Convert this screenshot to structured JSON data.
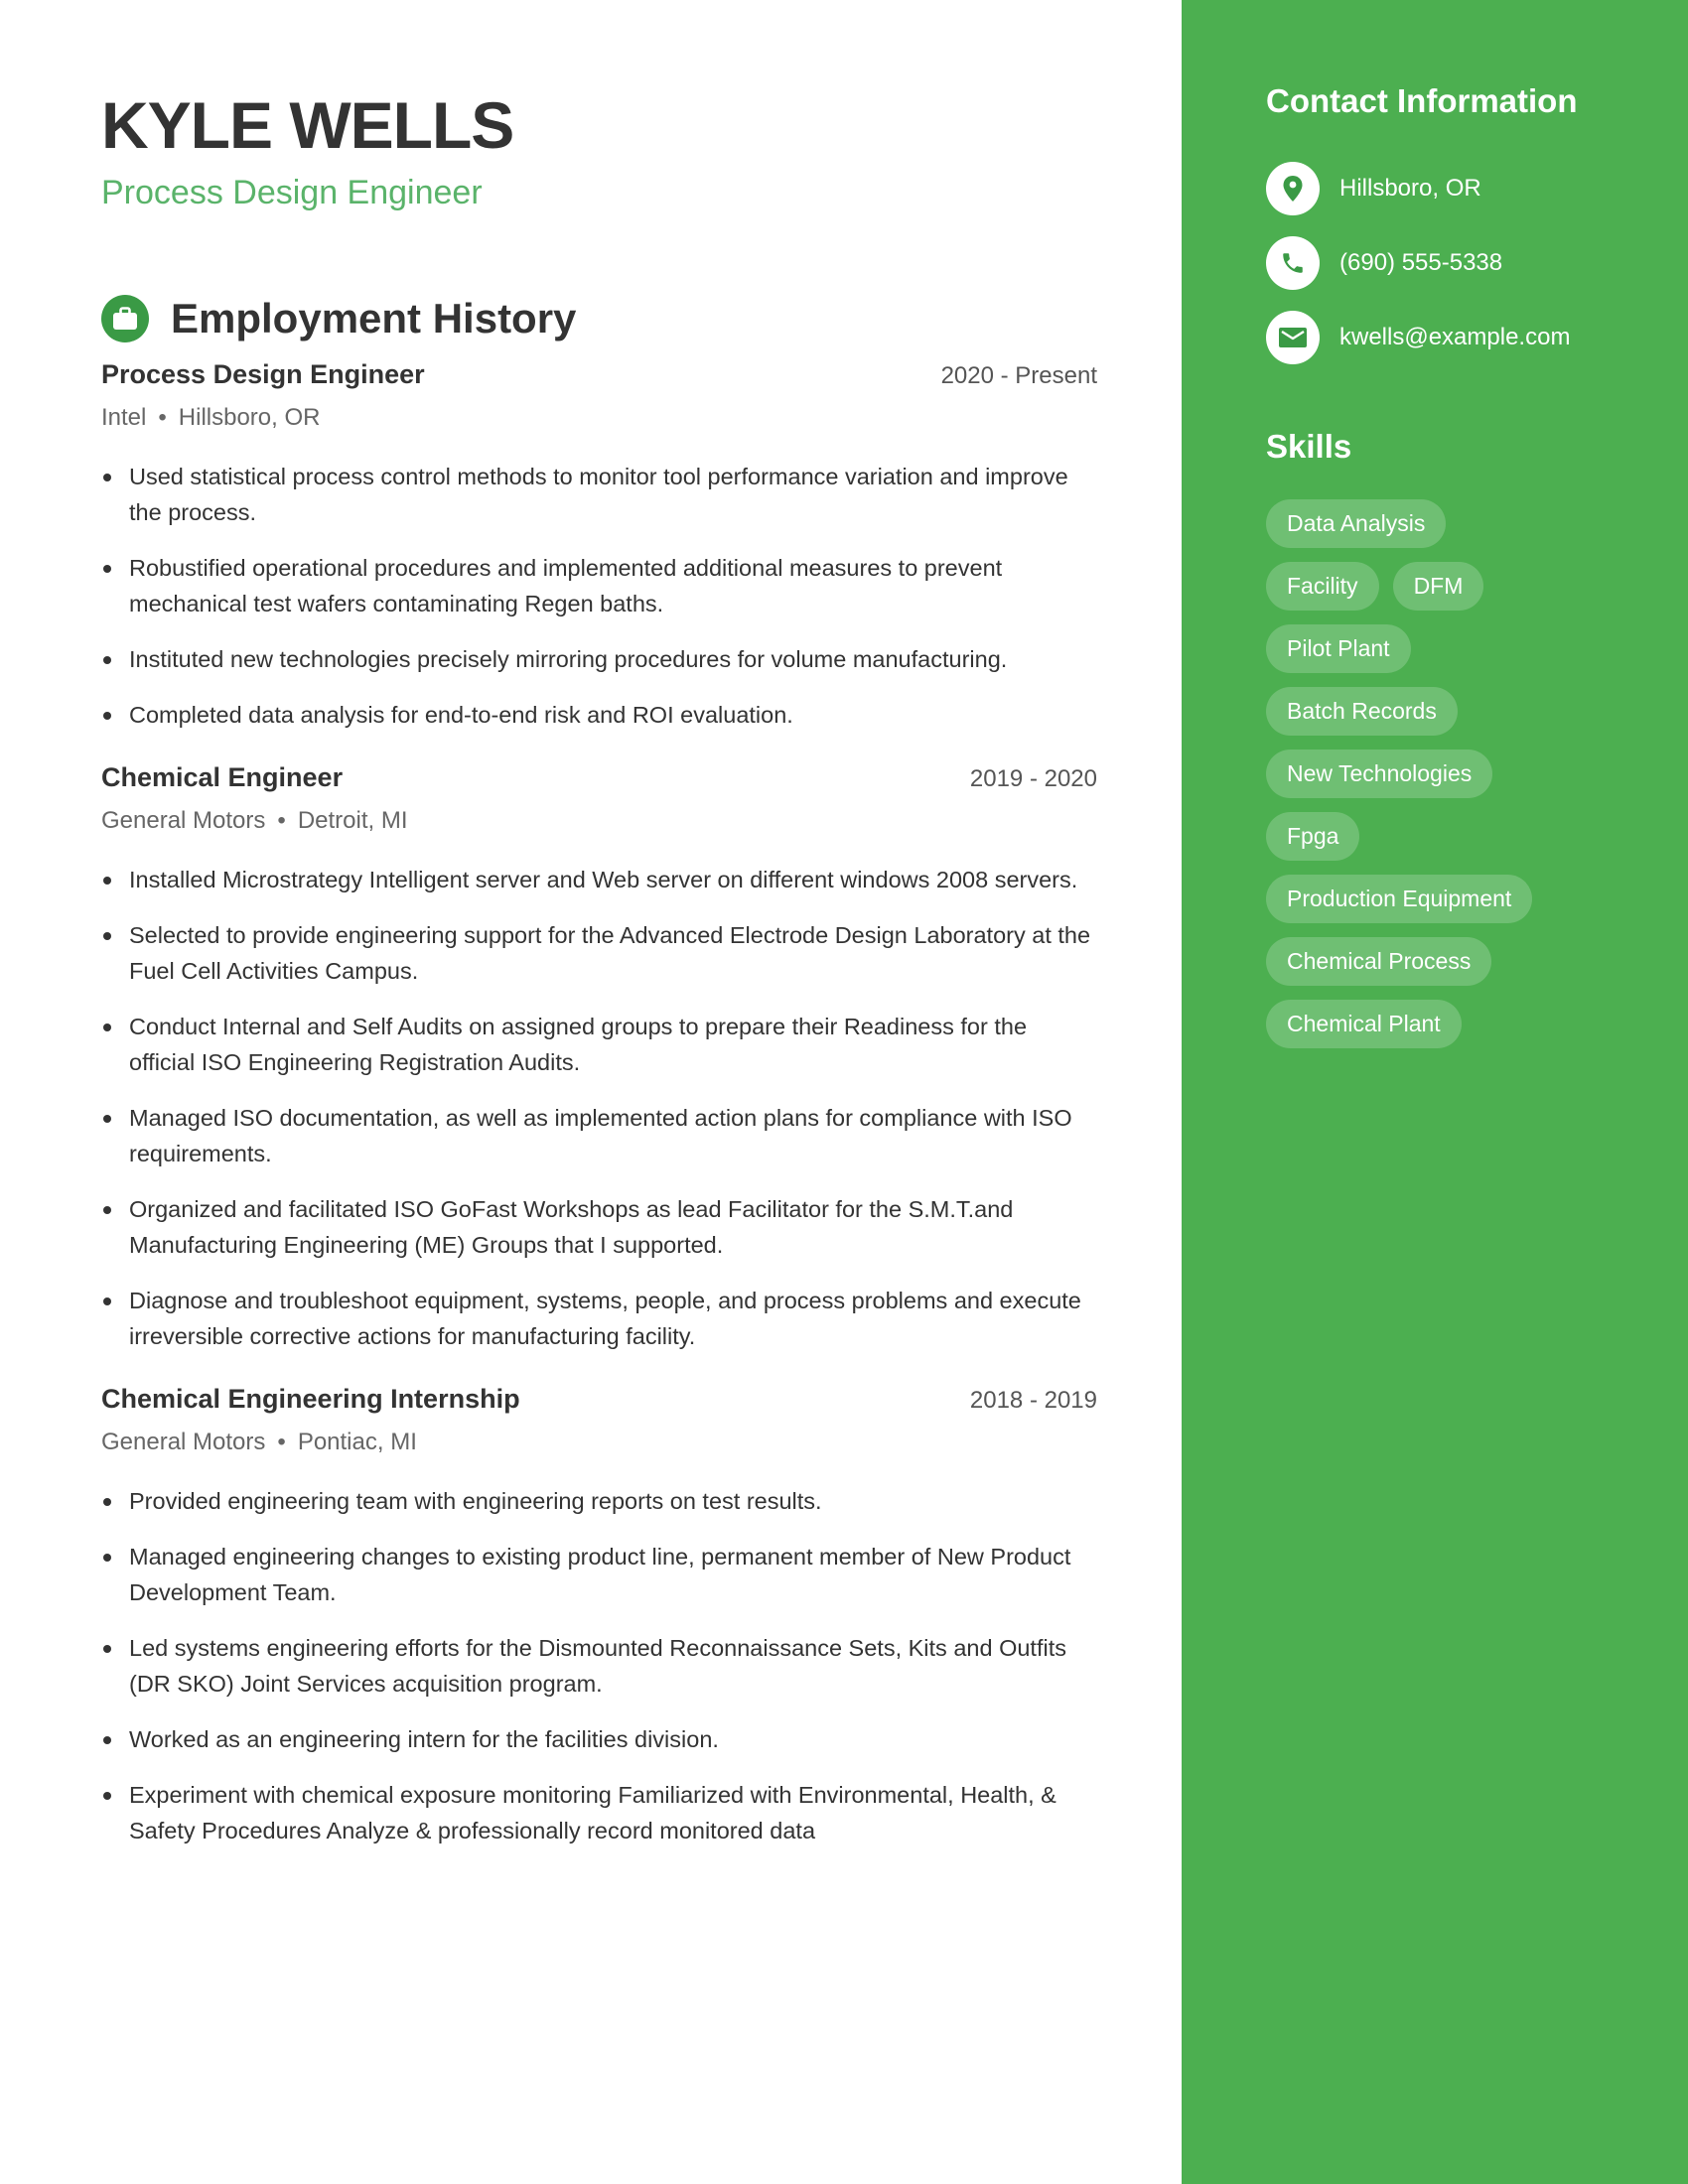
{
  "header": {
    "name": "KYLE WELLS",
    "title": "Process Design Engineer"
  },
  "employment": {
    "section_title": "Employment History",
    "section_icon": "briefcase-icon",
    "jobs": [
      {
        "title": "Process Design Engineer",
        "dates": "2020 - Present",
        "company": "Intel",
        "location": "Hillsboro, OR",
        "bullets": [
          "Used statistical process control methods to monitor tool performance variation and improve the process.",
          "Robustified operational procedures and implemented additional measures to prevent mechanical test wafers contaminating Regen baths.",
          "Instituted new technologies precisely mirroring procedures for volume manufacturing.",
          "Completed data analysis for end-to-end risk and ROI evaluation."
        ]
      },
      {
        "title": "Chemical Engineer",
        "dates": "2019 - 2020",
        "company": "General Motors",
        "location": "Detroit, MI",
        "bullets": [
          "Installed Microstrategy Intelligent server and Web server on different windows 2008 servers.",
          "Selected to provide engineering support for the Advanced Electrode Design Laboratory at the Fuel Cell Activities Campus.",
          "Conduct Internal and Self Audits on assigned groups to prepare their Readiness for the official ISO Engineering Registration Audits.",
          "Managed ISO documentation, as well as implemented action plans for compliance with ISO requirements.",
          "Organized and facilitated ISO GoFast Workshops as lead Facilitator for the S.M.T.and Manufacturing Engineering (ME) Groups that I supported.",
          "Diagnose and troubleshoot equipment, systems, people, and process problems and execute irreversible corrective actions for manufacturing facility."
        ]
      },
      {
        "title": "Chemical Engineering Internship",
        "dates": "2018 - 2019",
        "company": "General Motors",
        "location": "Pontiac, MI",
        "bullets": [
          "Provided engineering team with engineering reports on test results.",
          "Managed engineering changes to existing product line, permanent member of New Product Development Team.",
          "Led systems engineering efforts for the Dismounted Reconnaissance Sets, Kits and Outfits (DR SKO) Joint Services acquisition program.",
          "Worked as an engineering intern for the facilities division.",
          "Experiment with chemical exposure monitoring Familiarized with Environmental, Health, & Safety Procedures Analyze & professionally record monitored data"
        ]
      }
    ]
  },
  "sidebar": {
    "contact_title": "Contact Information",
    "contact": [
      {
        "icon": "location-pin-icon",
        "text": "Hillsboro, OR"
      },
      {
        "icon": "phone-icon",
        "text": "(690) 555-5338"
      },
      {
        "icon": "email-icon",
        "text": "kwells@example.com"
      }
    ],
    "skills_title": "Skills",
    "skills": [
      "Data Analysis",
      "Facility",
      "DFM",
      "Pilot Plant",
      "Batch Records",
      "New Technologies",
      "Fpga",
      "Production Equipment",
      "Chemical Process",
      "Chemical Plant"
    ]
  },
  "colors": {
    "sidebar_green": "#4caf50",
    "accent_green": "#5ab36a",
    "icon_green": "#3a9a45",
    "text_dark": "#333333",
    "text_muted": "#666666"
  }
}
